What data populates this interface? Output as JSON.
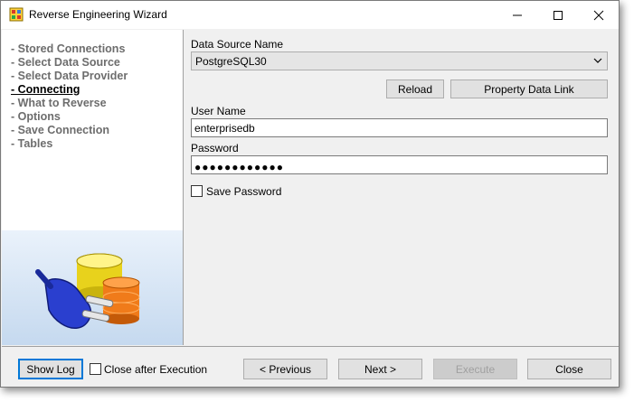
{
  "window": {
    "title": "Reverse Engineering Wizard",
    "app_icon": "database-wizard-icon",
    "controls": [
      "minimize-icon",
      "maximize-icon",
      "close-icon"
    ]
  },
  "steps": [
    {
      "label": "- Stored Connections",
      "active": false
    },
    {
      "label": "- Select Data Source",
      "active": false
    },
    {
      "label": "- Select Data Provider",
      "active": false
    },
    {
      "label": "- Connecting",
      "active": true
    },
    {
      "label": "- What to Reverse",
      "active": false
    },
    {
      "label": "- Options",
      "active": false
    },
    {
      "label": "- Save Connection",
      "active": false
    },
    {
      "label": "- Tables",
      "active": false
    }
  ],
  "form": {
    "data_source_label": "Data Source Name",
    "data_source_value": "PostgreSQL30",
    "reload_label": "Reload",
    "property_link_label": "Property Data Link",
    "user_name_label": "User Name",
    "user_name_value": "enterprisedb",
    "password_label": "Password",
    "password_mask": "●●●●●●●●●●●●",
    "save_password_label": "Save Password",
    "save_password_checked": false
  },
  "footer": {
    "show_log_label": "Show Log",
    "close_after_label": "Close after Execution",
    "close_after_checked": false,
    "previous_label": "< Previous",
    "next_label": "Next >",
    "execute_label": "Execute",
    "close_label": "Close"
  },
  "colors": {
    "accent": "#0078d7",
    "panel_bg": "#f0f0f0",
    "step_inactive": "#6d6d6d",
    "step_active": "#000000"
  }
}
